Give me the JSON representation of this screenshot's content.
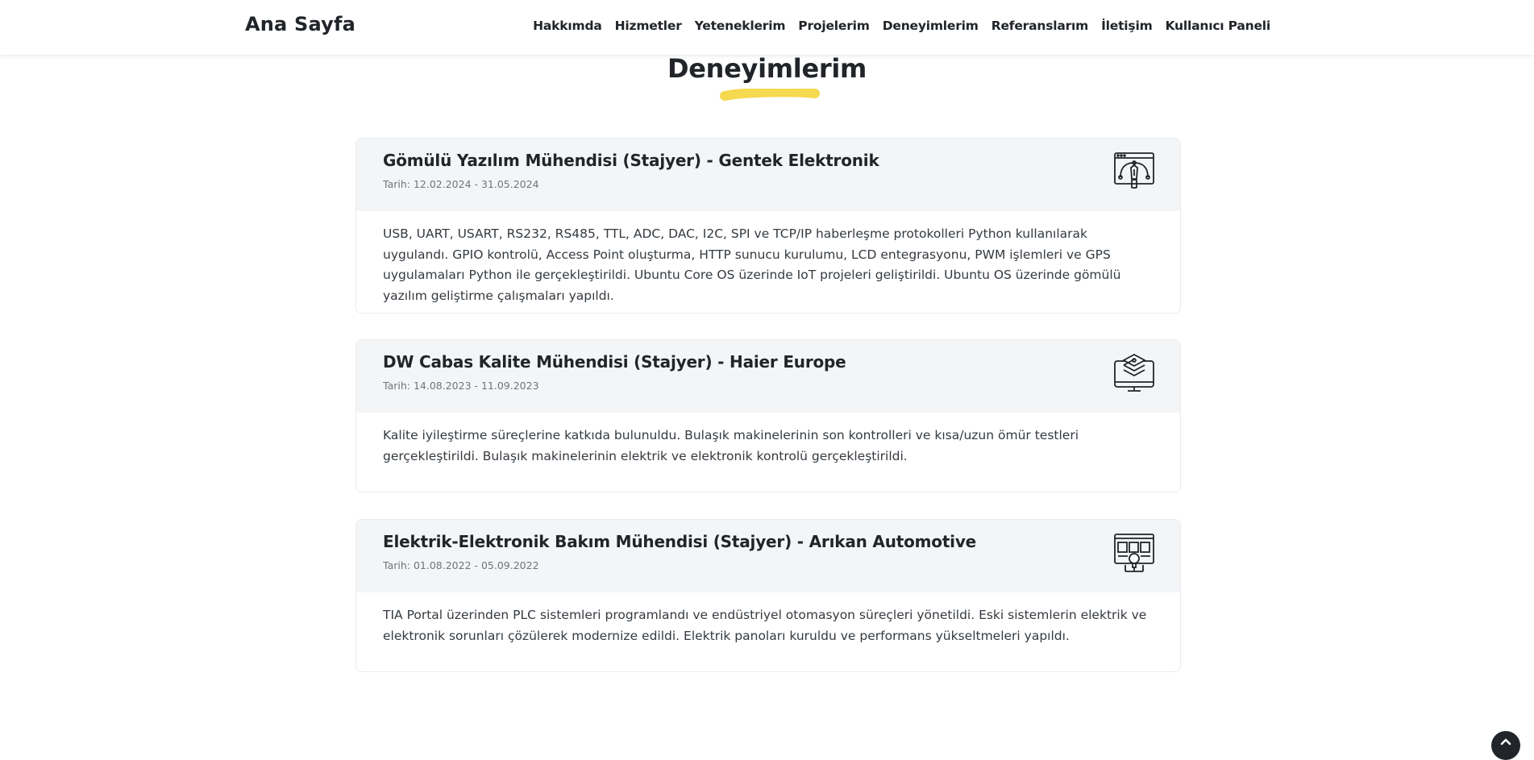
{
  "navbar": {
    "brand": "Ana Sayfa",
    "links": [
      "Hakkımda",
      "Hizmetler",
      "Yeteneklerim",
      "Projelerim",
      "Deneyimlerim",
      "Referanslarım",
      "İletişim",
      "Kullanıcı Paneli"
    ]
  },
  "section": {
    "title": "Deneyimlerim",
    "underline_color": "#f5d94e"
  },
  "experiences": [
    {
      "title": "Gömülü Yazılım Mühendisi (Stajyer) - Gentek Elektronik",
      "date": "Tarih: 12.02.2024 - 31.05.2024",
      "description": "USB, UART, USART, RS232, RS485, TTL, ADC, DAC, I2C, SPI ve TCP/IP haberleşme protokolleri Python kullanılarak uygulandı. GPIO kontrolü, Access Point oluşturma, HTTP sunucu kurulumu, LCD entegrasyonu, PWM işlemleri ve GPS uygulamaları Python ile gerçekleştirildi. Ubuntu Core OS üzerinde IoT projeleri geliştirildi. Ubuntu OS üzerinde gömülü yazılım geliştirme çalışmaları yapıldı.",
      "icon": "web-design-pen-icon"
    },
    {
      "title": "DW Cabas Kalite Mühendisi (Stajyer) - Haier Europe",
      "date": "Tarih: 14.08.2023 - 11.09.2023",
      "description": "Kalite iyileştirme süreçlerine katkıda bulunuldu. Bulaşık makinelerinin son kontrolleri ve kısa/uzun ömür testleri gerçekleştirildi. Bulaşık makinelerinin elektrik ve elektronik kontrolü gerçekleştirildi.",
      "icon": "monitor-layers-icon"
    },
    {
      "title": "Elektrik-Elektronik Bakım Mühendisi (Stajyer) - Arıkan Automotive",
      "date": "Tarih: 01.08.2022 - 05.09.2022",
      "description": "TIA Portal üzerinden PLC sistemleri programlandı ve endüstriyel otomasyon süreçleri yönetildi. Eski sistemlerin elektrik ve elektronik sorunları çözülerek modernize edildi. Elektrik panoları kuruldu ve performans yükseltmeleri yapıldı.",
      "icon": "monitor-bulb-icon"
    }
  ],
  "scroll_top": {
    "icon": "chevron-up-icon"
  }
}
